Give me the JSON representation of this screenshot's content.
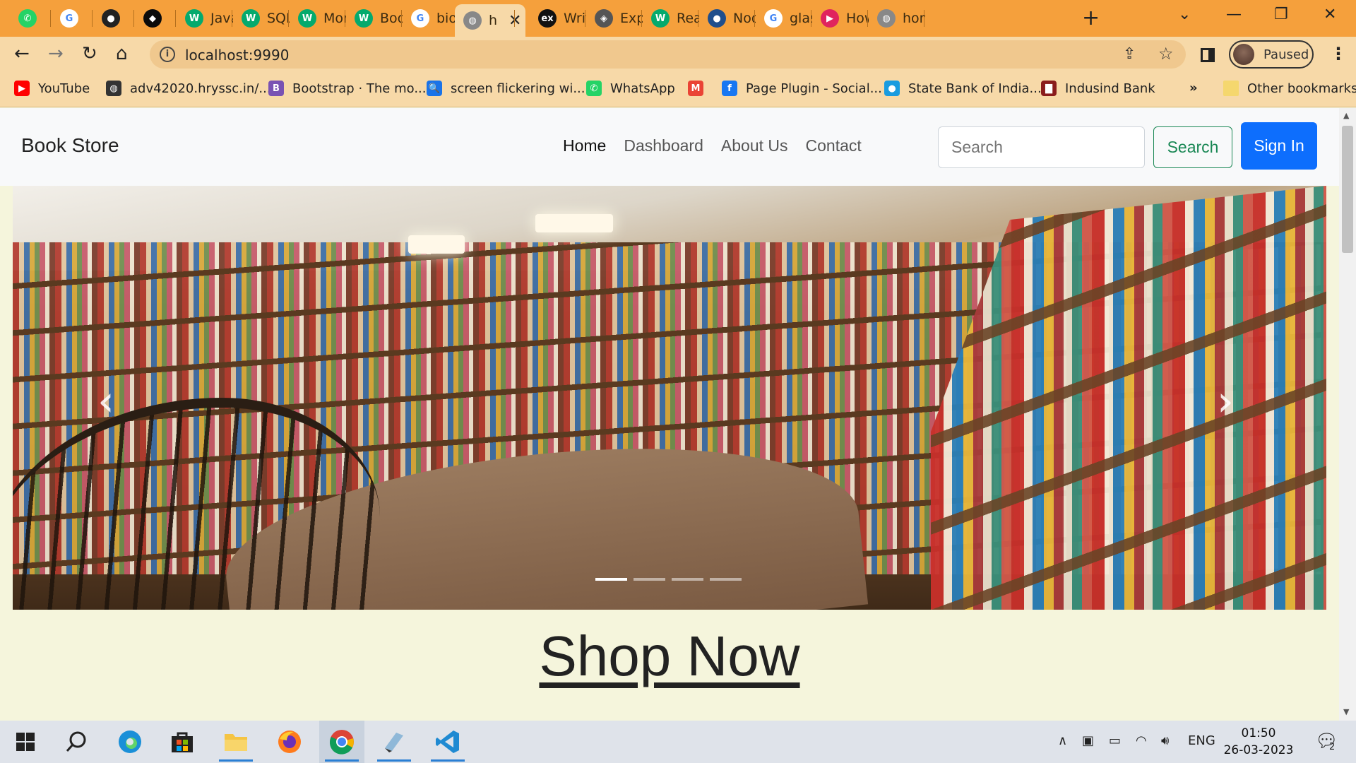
{
  "browser": {
    "tabs": [
      {
        "title": "",
        "icon": "whatsapp-icon",
        "color": "#25d366",
        "glyph": "✆"
      },
      {
        "title": "",
        "icon": "google-icon",
        "color": "#ffffff",
        "glyph": "G"
      },
      {
        "title": "",
        "icon": "github-icon",
        "color": "#222222",
        "glyph": "●"
      },
      {
        "title": "",
        "icon": "mongodb-icon",
        "color": "#0b0b0b",
        "glyph": "◆"
      },
      {
        "title": "JavaS",
        "icon": "w3schools-icon",
        "color": "#04aa6d",
        "glyph": "W"
      },
      {
        "title": "SQL",
        "icon": "w3schools-icon",
        "color": "#04aa6d",
        "glyph": "W"
      },
      {
        "title": "Mon",
        "icon": "w3schools-icon",
        "color": "#04aa6d",
        "glyph": "W"
      },
      {
        "title": "Boot",
        "icon": "w3schools-icon",
        "color": "#04aa6d",
        "glyph": "W"
      },
      {
        "title": "biog",
        "icon": "google-icon",
        "color": "#ffffff",
        "glyph": "G"
      },
      {
        "title": "h",
        "icon": "globe-icon",
        "color": "#888888",
        "glyph": "◍",
        "active": true
      },
      {
        "title": "Writ",
        "icon": "express-icon",
        "color": "#111111",
        "glyph": "ex"
      },
      {
        "title": "Expr",
        "icon": "diamond-icon",
        "color": "#555555",
        "glyph": "◈"
      },
      {
        "title": "Reac",
        "icon": "w3schools-icon",
        "color": "#04aa6d",
        "glyph": "W"
      },
      {
        "title": "Nod",
        "icon": "github-icon",
        "color": "#1f4e8c",
        "glyph": "●"
      },
      {
        "title": "glas",
        "icon": "google-icon",
        "color": "#ffffff",
        "glyph": "G"
      },
      {
        "title": "How",
        "icon": "play-icon",
        "color": "#e0245e",
        "glyph": "▶"
      },
      {
        "title": "hom",
        "icon": "globe-icon",
        "color": "#888888",
        "glyph": "◍"
      }
    ],
    "url": "localhost:9990",
    "profile_label": "Paused",
    "bookmarks": [
      {
        "label": "YouTube",
        "icon": "youtube-icon",
        "color": "#ff0000",
        "glyph": "▶"
      },
      {
        "label": "adv42020.hryssc.in/...",
        "icon": "globe-icon",
        "color": "#333333",
        "glyph": "◍"
      },
      {
        "label": "Bootstrap · The mo...",
        "icon": "bootstrap-icon",
        "color": "#7952b3",
        "glyph": "B"
      },
      {
        "label": "screen flickering wi...",
        "icon": "search-icon",
        "color": "#1a73e8",
        "glyph": "🔍"
      },
      {
        "label": "WhatsApp",
        "icon": "whatsapp-icon",
        "color": "#25d366",
        "glyph": "✆"
      },
      {
        "label": "",
        "icon": "gmail-icon",
        "color": "#ea4335",
        "glyph": "M"
      },
      {
        "label": "Page Plugin - Social...",
        "icon": "facebook-icon",
        "color": "#1877f2",
        "glyph": "f"
      },
      {
        "label": "State Bank of India...",
        "icon": "sbi-icon",
        "color": "#1a9ce0",
        "glyph": "●"
      },
      {
        "label": "Indusind Bank",
        "icon": "indusind-icon",
        "color": "#8a1c1c",
        "glyph": "▇"
      }
    ],
    "bookmarks_overflow": "»",
    "other_bookmarks": "Other bookmarks"
  },
  "site": {
    "brand": "Book Store",
    "nav": [
      "Home",
      "Dashboard",
      "About Us",
      "Contact"
    ],
    "search_placeholder": "Search",
    "search_button": "Search",
    "signin_button": "Sign In",
    "carousel": {
      "prev": "‹",
      "next": "›",
      "slide_count": 4,
      "active_slide": 1
    },
    "cta": "Shop Now"
  },
  "taskbar": {
    "language": "ENG",
    "time": "01:50",
    "date": "26-03-2023",
    "notification_count": "2"
  }
}
